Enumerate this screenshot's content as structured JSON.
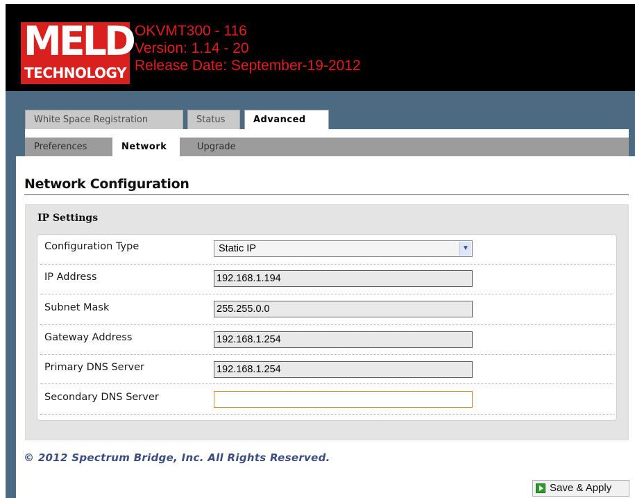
{
  "header": {
    "logo_text": "MELD",
    "logo_subtext": "TECHNOLOGY",
    "device_name": "OKVMT300 - 116",
    "version": "Version: 1.14 - 20",
    "release_date": "Release Date: September-19-2012"
  },
  "tabs": [
    {
      "label": "White Space Registration",
      "active": false
    },
    {
      "label": "Status",
      "active": false
    },
    {
      "label": "Advanced",
      "active": true
    }
  ],
  "subtabs": [
    {
      "label": "Preferences",
      "active": false
    },
    {
      "label": "Network",
      "active": true
    },
    {
      "label": "Upgrade",
      "active": false
    }
  ],
  "page_title": "Network Configuration",
  "section_title": "IP Settings",
  "form": {
    "configuration_type": {
      "label": "Configuration Type",
      "value": "Static IP"
    },
    "ip_address": {
      "label": "IP Address",
      "value": "192.168.1.194"
    },
    "subnet_mask": {
      "label": "Subnet Mask",
      "value": "255.255.0.0"
    },
    "gateway_address": {
      "label": "Gateway Address",
      "value": "192.168.1.254"
    },
    "primary_dns": {
      "label": "Primary DNS Server",
      "value": "192.168.1.254"
    },
    "secondary_dns": {
      "label": "Secondary DNS Server",
      "value": ""
    }
  },
  "footer_text": "© 2012 Spectrum Bridge, Inc. All Rights Reserved.",
  "save_button_label": "Save & Apply",
  "colors": {
    "header_bg": "#000000",
    "header_text": "#e31c1c",
    "logo_bg": "#d9201f",
    "band_bg": "#4c6b83",
    "footer_text": "#3c4d7f"
  },
  "icons": {
    "select_arrow": "chevron-down-icon",
    "save": "play-icon"
  }
}
